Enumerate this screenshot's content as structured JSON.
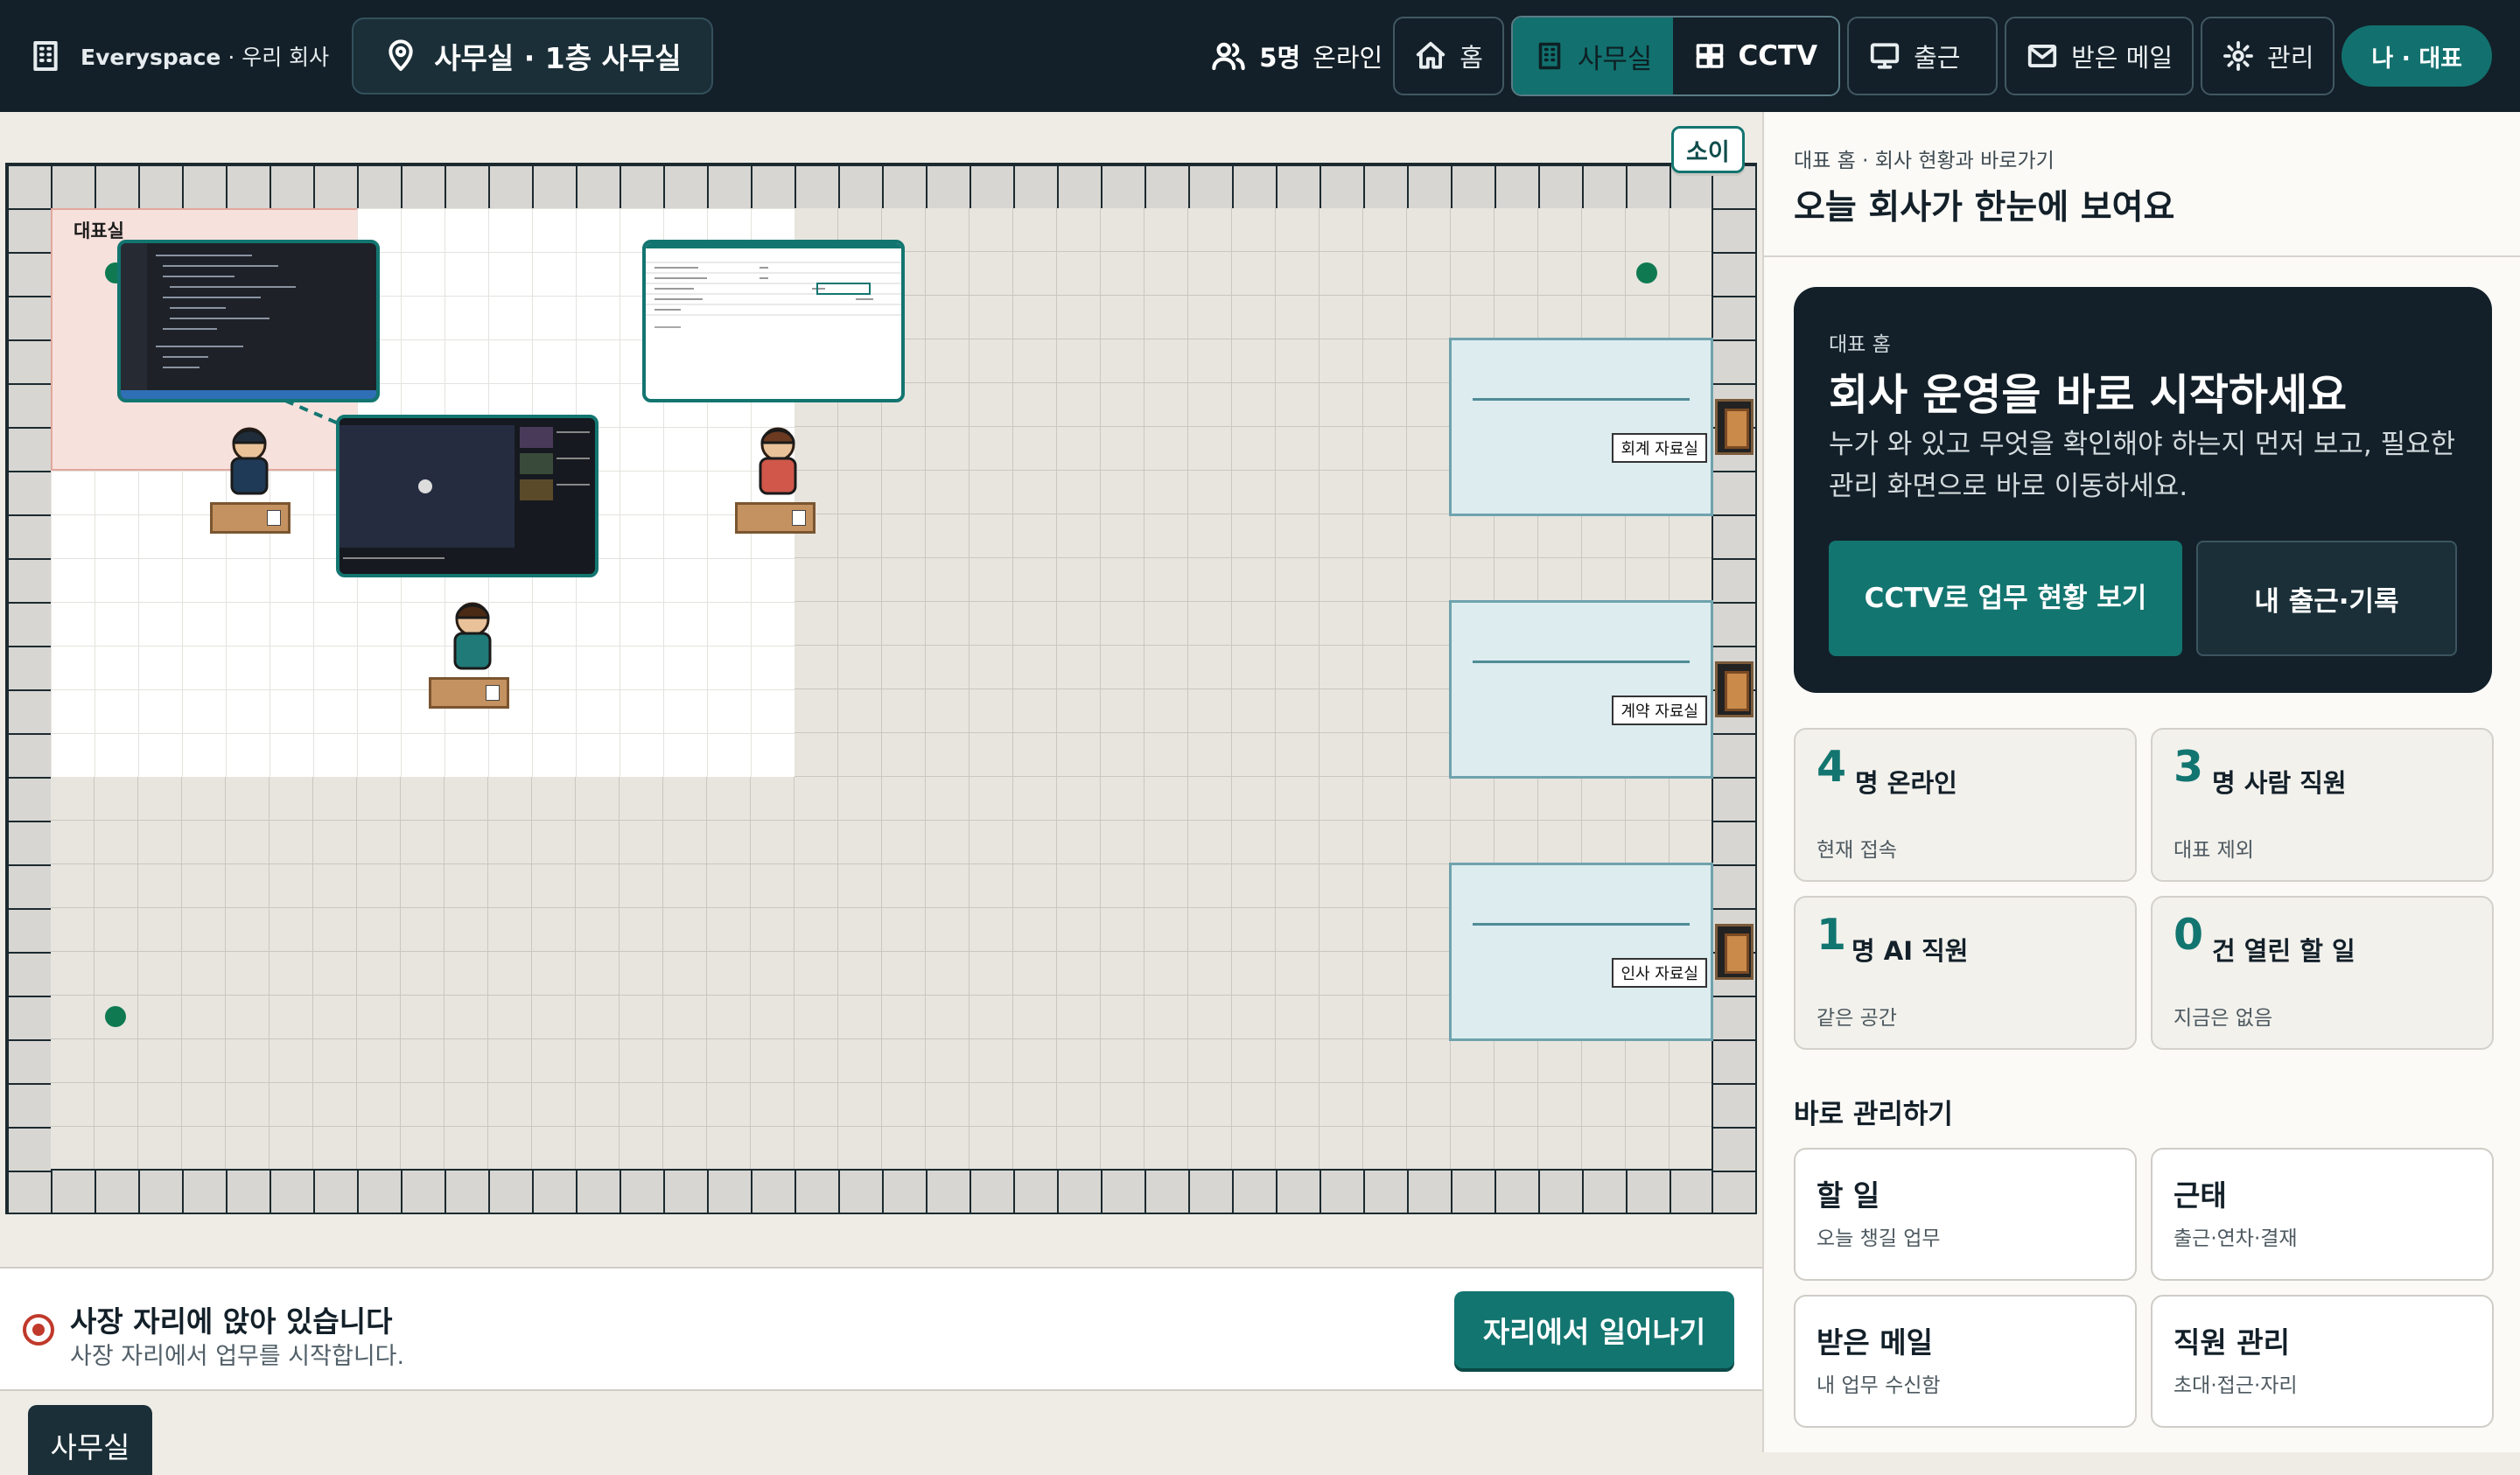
{
  "topbar": {
    "brand_name": "Everyspace",
    "brand_sub": "· 우리 회사",
    "location": "사무실 · 1층 사무실",
    "online_count": "5명",
    "online_label": "온라인",
    "nav": {
      "home": "홈",
      "office": "사무실",
      "cctv": "CCTV",
      "checkin": "출근",
      "inbox": "받은 메일",
      "admin": "관리",
      "me": "나 · 대표"
    }
  },
  "map": {
    "ceo_room_label": "대표실",
    "archives": [
      "회계 자료실",
      "계약 자료실",
      "인사 자료실"
    ],
    "badge": "소이"
  },
  "status_bar": {
    "title": "사장 자리에 앉아 있습니다",
    "subtitle": "사장 자리에서 업무를 시작합니다.",
    "button": "자리에서 일어나기"
  },
  "floor_tab": "사무실",
  "sidebar": {
    "breadcrumb": "대표 홈 · 회사 현황과 바로가기",
    "title": "오늘 회사가 한눈에 보여요",
    "hero": {
      "kicker": "대표 홈",
      "heading": "회사 운영을 바로 시작하세요",
      "desc": "누가 와 있고 무엇을 확인해야 하는지 먼저 보고, 필요한 관리 화면으로 바로 이동하세요.",
      "primary": "CCTV로 업무 현황 보기",
      "secondary": "내 출근·기록"
    },
    "stats": [
      {
        "value": "4",
        "unit": "명 온라인",
        "sub": "현재 접속"
      },
      {
        "value": "3",
        "unit": "명 사람 직원",
        "sub": "대표 제외"
      },
      {
        "value": "1",
        "unit": "명 AI 직원",
        "sub": "같은 공간"
      },
      {
        "value": "0",
        "unit": "건 열린 할 일",
        "sub": "지금은 없음"
      }
    ],
    "section_title": "바로 관리하기",
    "quick": [
      {
        "title": "할 일",
        "sub": "오늘 챙길 업무"
      },
      {
        "title": "근태",
        "sub": "출근·연차·결재"
      },
      {
        "title": "받은 메일",
        "sub": "내 업무 수신함"
      },
      {
        "title": "직원 관리",
        "sub": "초대·접근·자리"
      }
    ]
  },
  "colors": {
    "navy": "#132029",
    "teal": "#137570",
    "alert": "#c0392b",
    "online_dot": "#0f7a52"
  }
}
